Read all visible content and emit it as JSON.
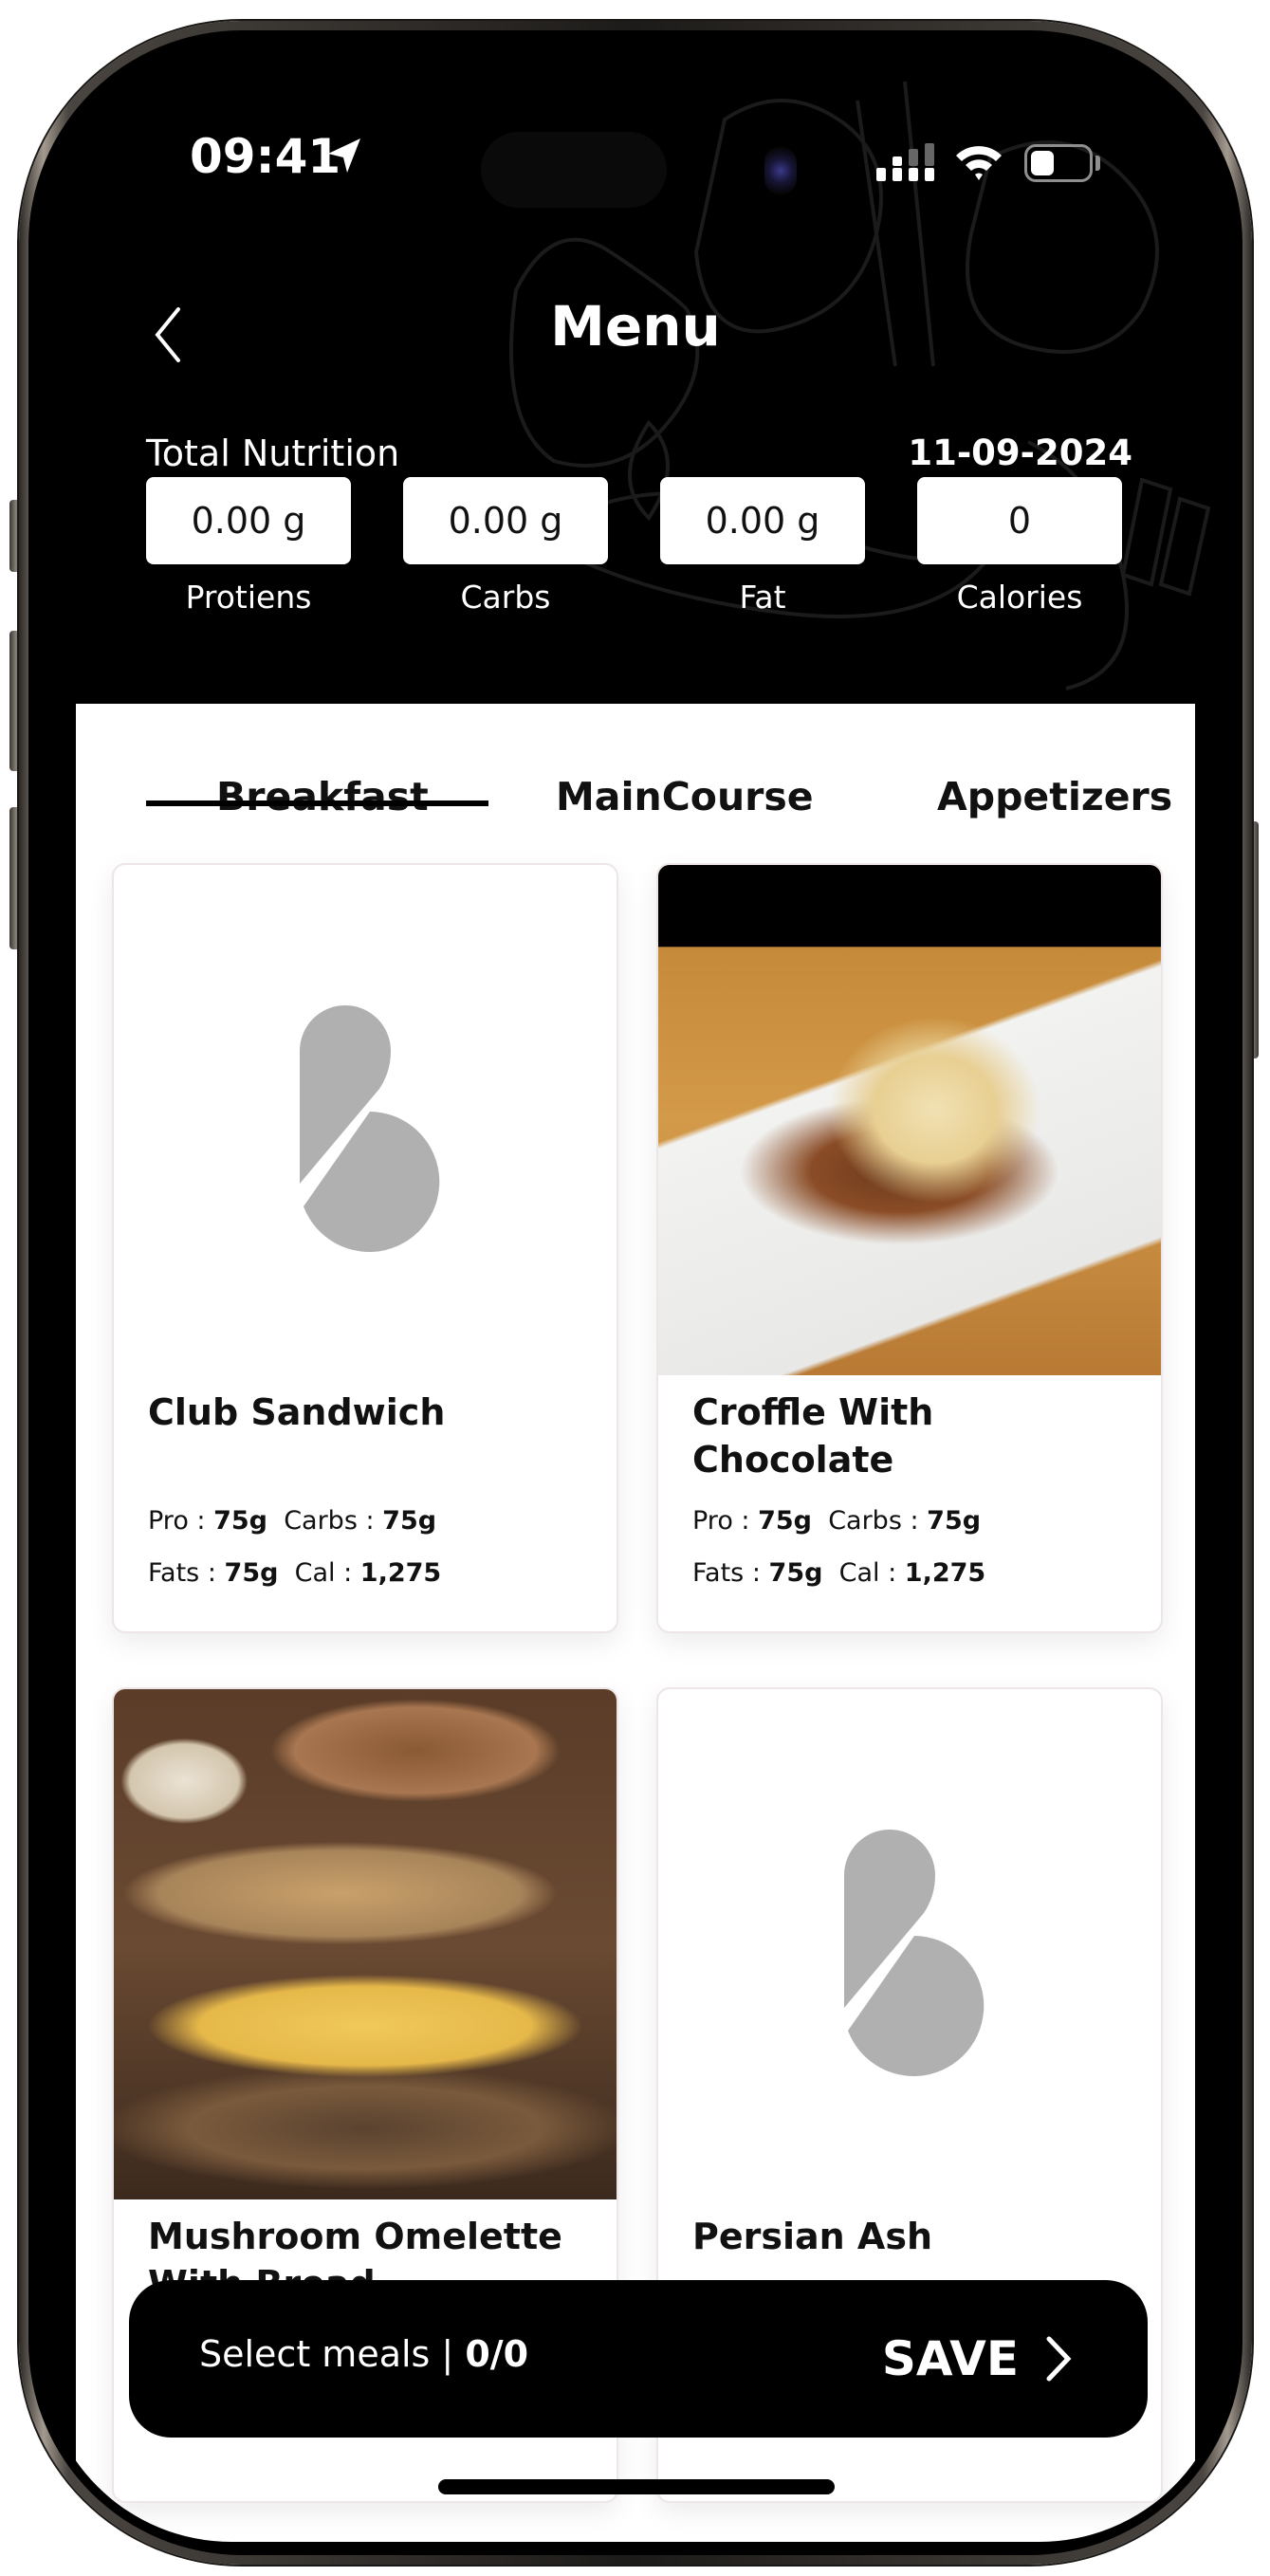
{
  "status_bar": {
    "time": "09:41",
    "icons": [
      "location-arrow-icon",
      "cellular-signal-icon",
      "wifi-icon",
      "battery-icon"
    ]
  },
  "header": {
    "back_icon": "chevron-left-icon",
    "title": "Menu",
    "total_nutrition_label": "Total Nutrition",
    "date": "11-09-2024"
  },
  "nutrition": [
    {
      "value": "0.00 g",
      "label": "Protiens"
    },
    {
      "value": "0.00 g",
      "label": "Carbs"
    },
    {
      "value": "0.00 g",
      "label": "Fat"
    },
    {
      "value": "0",
      "label": "Calories"
    }
  ],
  "tabs": [
    {
      "label": "Breakfast",
      "active": true
    },
    {
      "label": "MainCourse",
      "active": false
    },
    {
      "label": "Appetizers",
      "active": false
    }
  ],
  "meals": [
    {
      "name": "Club Sandwich",
      "image": "placeholder-logo",
      "pro_label": "Pro :",
      "pro": "75g",
      "carbs_label": "Carbs :",
      "carbs": "75g",
      "fats_label": "Fats :",
      "fats": "75g",
      "cal_label": "Cal :",
      "cal": "1,275"
    },
    {
      "name": "Croffle With Chocolate",
      "image": "croffle-photo",
      "pro_label": "Pro :",
      "pro": "75g",
      "carbs_label": "Carbs :",
      "carbs": "75g",
      "fats_label": "Fats :",
      "fats": "75g",
      "cal_label": "Cal :",
      "cal": "1,275"
    },
    {
      "name": "Mushroom Omelette With Bread",
      "image": "omelette-photo"
    },
    {
      "name": "Persian Ash",
      "image": "placeholder-logo"
    }
  ],
  "save_bar": {
    "select_label": "Select meals |",
    "count": "0/0",
    "save_label": "SAVE",
    "save_icon": "chevron-right-icon"
  },
  "colors": {
    "header_bg": "#000000",
    "panel_bg": "#ffffff",
    "placeholder_gray": "#b0b0b0",
    "accent": "#000000"
  }
}
